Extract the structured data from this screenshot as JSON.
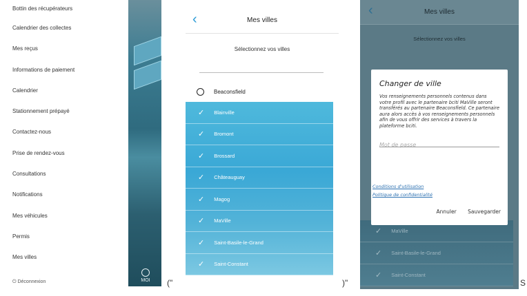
{
  "side_menu": {
    "items": [
      "Bottin des récupérateurs",
      "Calendrier des collectes",
      "Mes reçus",
      "Informations de paiement",
      "Calendrier",
      "Stationnement prépayé",
      "Contactez-nous",
      "Prise de rendez-vous",
      "Consultations",
      "Notifications",
      "Mes véhicules",
      "Permis",
      "Mes villes"
    ],
    "bottom_label": "Déconnexion",
    "me_label": "MOI"
  },
  "cities_screen": {
    "title": "Mes villes",
    "subtitle": "Sélectionnez vos villes",
    "unselected": [
      "Beaconsfield"
    ],
    "selected": [
      "Blainville",
      "Bromont",
      "Brossard",
      "Châteauguay",
      "Magog",
      "MaVille",
      "Saint-Basile-le-Grand",
      "Saint-Constant"
    ]
  },
  "dialog_screen": {
    "title": "Mes villes",
    "subtitle": "Sélectionnez vos villes",
    "background_rows": [
      "MaVille",
      "Saint-Basile-le-Grand",
      "Saint-Constant"
    ],
    "dialog": {
      "title": "Changer de ville",
      "body": "Vos renseignements personnels contenus dans votre profil avec le partenaire bciti MaVille seront transférés au partenaire Beaconsfield. Ce partenaire aura alors accès à vos renseignements personnels afin de vous offrir des services à travers la plateforme bciti.",
      "password_placeholder": "Mot de passe",
      "terms_link": "Conditions d'utilisation",
      "privacy_link": "Politique de confidentialité",
      "cancel": "Annuler",
      "save": "Sauvegarder"
    }
  },
  "stray_text": {
    "a": "(\"",
    "b": ")\"",
    "c": "S"
  },
  "colors": {
    "accent": "#2b9bd6",
    "selected_row": "#3aa8d6"
  }
}
